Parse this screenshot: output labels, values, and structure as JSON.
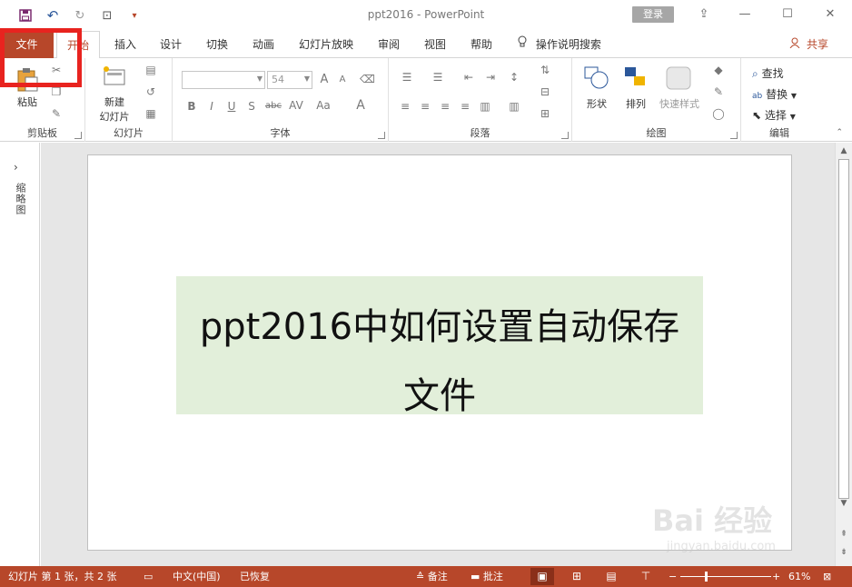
{
  "window": {
    "title": "ppt2016 - PowerPoint",
    "login_label": "登录",
    "minimize_glyph": "—",
    "restore_glyph": "☐",
    "close_glyph": "✕",
    "ribbon_display_glyph": "⇪"
  },
  "qat": {
    "save_icon": "save-icon",
    "undo_glyph": "↶",
    "redo_glyph": "↻",
    "present_glyph": "⊡",
    "more_glyph": "▾"
  },
  "tabs": [
    {
      "label": "文件"
    },
    {
      "label": "开始"
    },
    {
      "label": "插入"
    },
    {
      "label": "设计"
    },
    {
      "label": "切换"
    },
    {
      "label": "动画"
    },
    {
      "label": "幻灯片放映"
    },
    {
      "label": "审阅"
    },
    {
      "label": "视图"
    },
    {
      "label": "帮助"
    }
  ],
  "tellme": {
    "label": "操作说明搜索",
    "icon": "lightbulb-icon"
  },
  "share": {
    "label": "共享",
    "icon": "person-icon"
  },
  "ribbon": {
    "clipboard": {
      "label": "剪贴板",
      "paste_label": "粘贴"
    },
    "slides": {
      "label": "幻灯片",
      "new_slide_label_1": "新建",
      "new_slide_label_2": "幻灯片"
    },
    "font": {
      "label": "字体",
      "font_name_value": "",
      "font_size_value": "54",
      "bold": "B",
      "italic": "I",
      "underline": "U",
      "strike": "S",
      "abc": "abc",
      "av": "AV",
      "aa": "Aa",
      "color_a": "A",
      "grow": "A",
      "shrink": "A"
    },
    "paragraph": {
      "label": "段落"
    },
    "drawing": {
      "label": "绘图",
      "shapes_label": "形状",
      "arrange_label": "排列",
      "quickstyle_label": "快速样式"
    },
    "editing": {
      "label": "编辑",
      "find_label": "查找",
      "replace_label": "替换",
      "select_label": "选择"
    }
  },
  "sidepanel": {
    "label": "缩略图",
    "chevron": "›"
  },
  "slide": {
    "title_text": "ppt2016中如何设置自动保存文件"
  },
  "watermark": {
    "line1": "Bai 经验",
    "line2": "jingyan.baidu.com"
  },
  "status": {
    "slide_info": "幻灯片 第 1 张，共 2 张",
    "language": "中文(中国)",
    "recovered": "已恢复",
    "notes_label": "备注",
    "comments_label": "批注",
    "zoom_minus": "−",
    "zoom_plus": "+",
    "zoom_percent": "61%",
    "zoom_value": 0.61
  },
  "colors": {
    "accent": "#b7472a",
    "title_fill": "#e2efda",
    "annotation": "#e8231f"
  }
}
